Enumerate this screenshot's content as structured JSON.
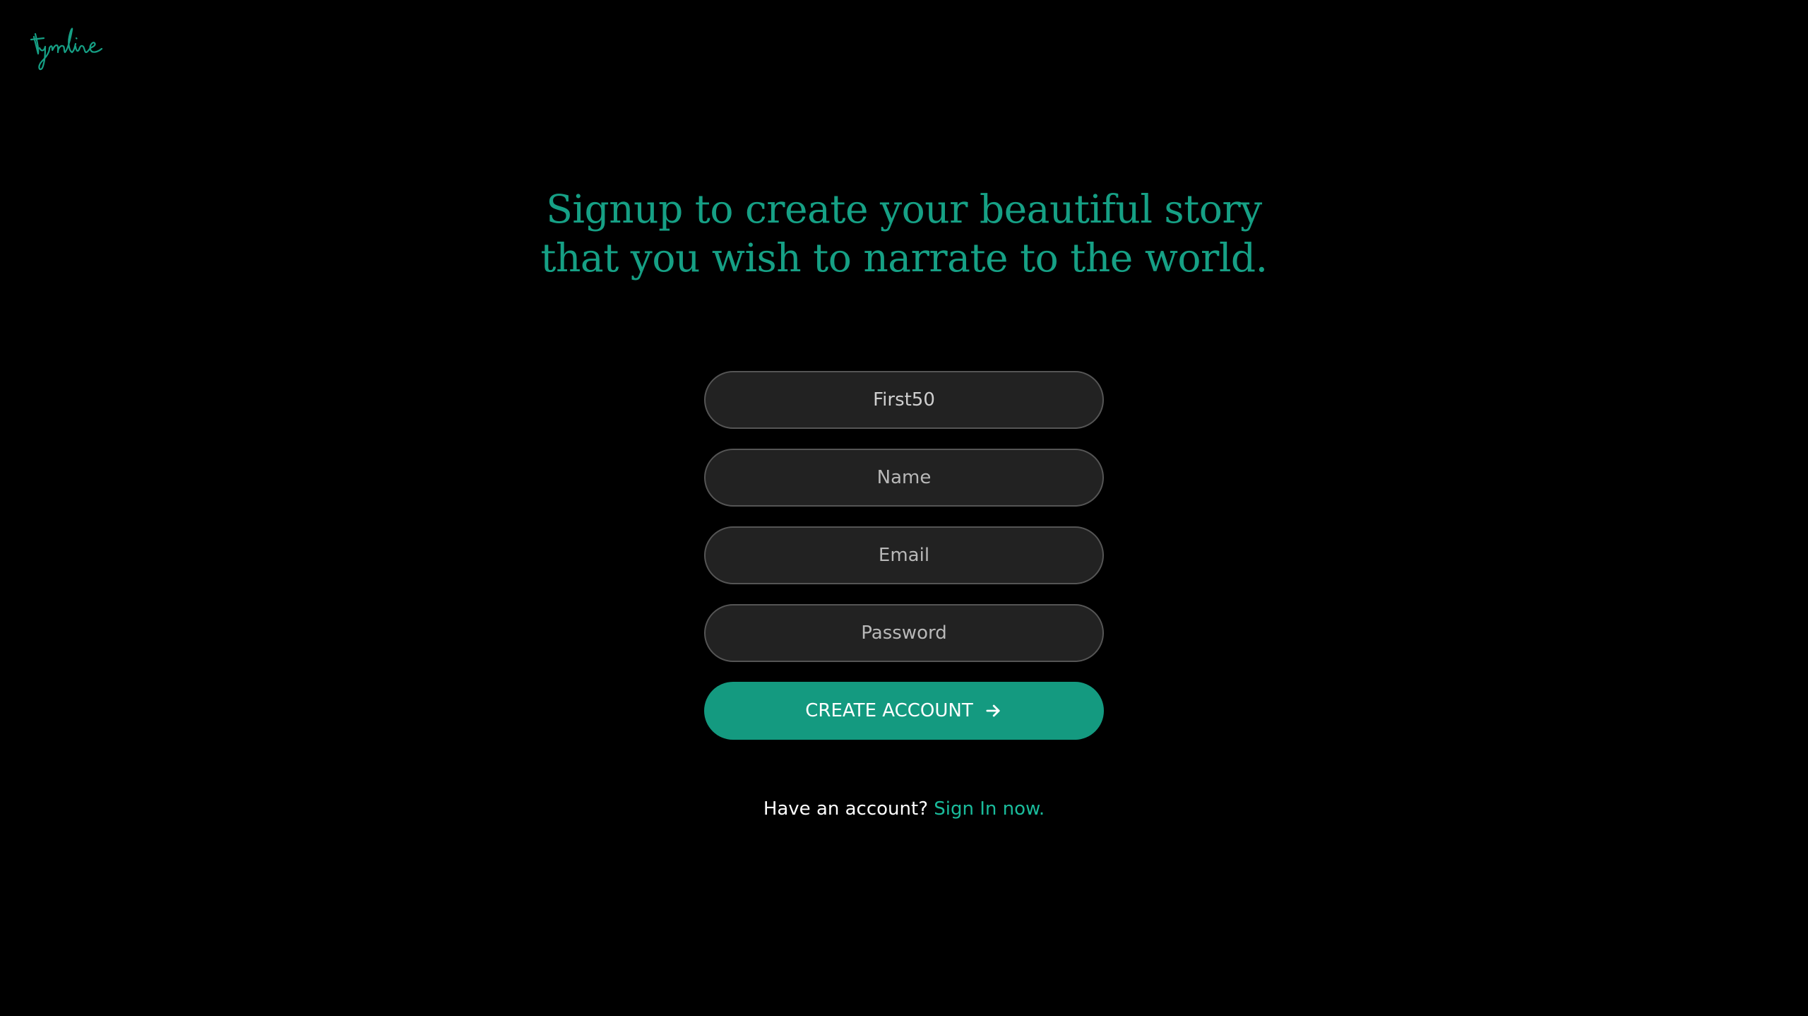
{
  "brand": {
    "logo_text": "tymline",
    "accent_color": "#16a085",
    "button_color": "#149a80",
    "background_color": "#000000"
  },
  "headline": {
    "line1": "Signup to create your beautiful story",
    "line2": "that you wish to narrate to the world."
  },
  "form": {
    "coupon": {
      "value": "First50",
      "placeholder": ""
    },
    "name": {
      "value": "",
      "placeholder": "Name"
    },
    "email": {
      "value": "",
      "placeholder": "Email"
    },
    "password": {
      "value": "",
      "placeholder": "Password"
    },
    "submit_label": "CREATE ACCOUNT",
    "submit_icon": "arrow-right-icon"
  },
  "footer": {
    "prompt": "Have an account?",
    "link_label": "Sign In now."
  }
}
